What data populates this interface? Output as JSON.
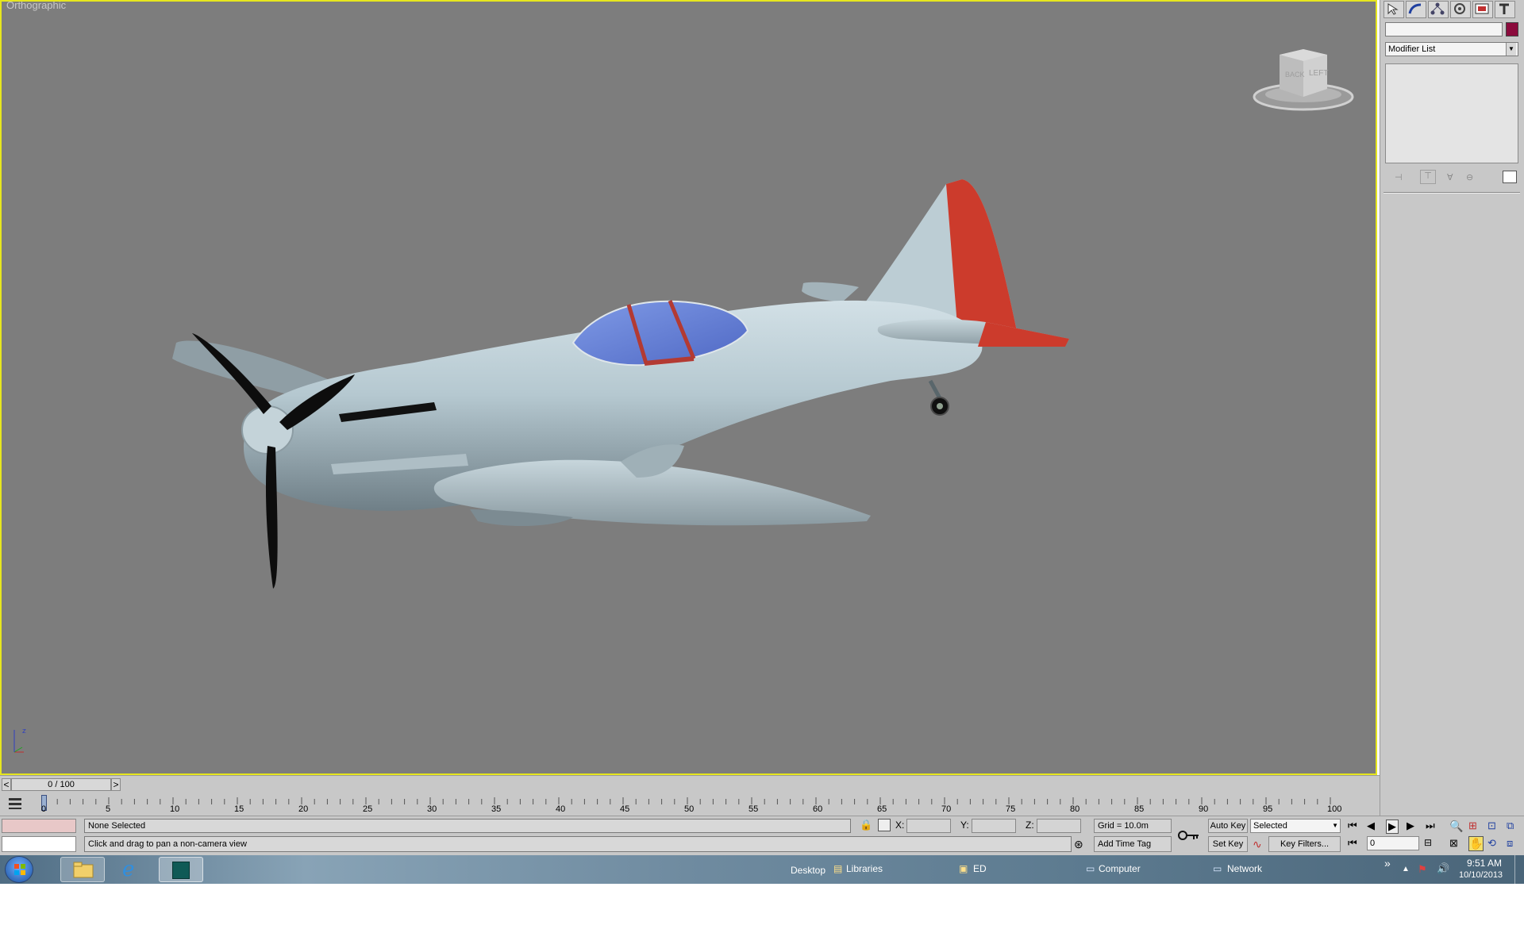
{
  "viewport": {
    "label": "Orthographic",
    "viewcube": {
      "face_back": "BACK",
      "face_left": "LEFT"
    }
  },
  "command_panel": {
    "tabs": [
      "create-icon",
      "modify-icon",
      "hierarchy-icon",
      "motion-icon",
      "display-icon",
      "utilities-icon"
    ],
    "object_name_value": "",
    "object_color": "#8b0a3c",
    "modifier_list_label": "Modifier List"
  },
  "time_slider": {
    "label": "0 / 100",
    "prev": "<",
    "next": ">"
  },
  "trackbar": {
    "ticks": [
      "0",
      "5",
      "10",
      "15",
      "20",
      "25",
      "30",
      "35",
      "40",
      "45",
      "50",
      "55",
      "60",
      "65",
      "70",
      "75",
      "80",
      "85",
      "90",
      "95",
      "100"
    ]
  },
  "status": {
    "selection_text": "None Selected",
    "prompt_text": "Click and drag to pan a non-camera view",
    "x_label": "X:",
    "x_value": "",
    "y_label": "Y:",
    "y_value": "",
    "z_label": "Z:",
    "z_value": "",
    "grid_label": "Grid = 10.0m",
    "add_time_tag": "Add Time Tag",
    "auto_key": "Auto Key",
    "set_key": "Set Key",
    "selected_option": "Selected",
    "key_filters": "Key Filters...",
    "frame_value": "0"
  },
  "taskbar": {
    "desktop": "Desktop",
    "libraries": "Libraries",
    "ed": "ED",
    "computer": "Computer",
    "network": "Network",
    "overflow": "»",
    "time": "9:51 AM",
    "date": "10/10/2013"
  },
  "colors": {
    "viewport_bg": "#7d7d7d",
    "active_border": "#e6e61e",
    "fuselage": "#b4c7cf",
    "tail_red": "#cc3b2c",
    "canopy_blue": "#5b78d0"
  }
}
